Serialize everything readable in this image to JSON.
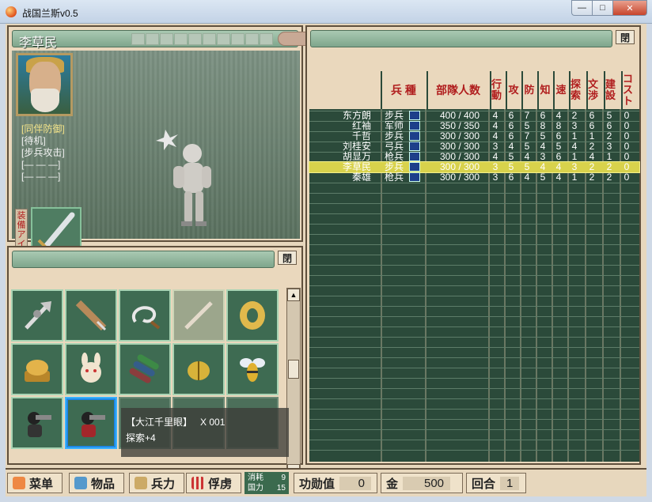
{
  "window": {
    "title": "战国兰斯v0.5",
    "minimize": "—",
    "maximize": "□",
    "close": "✕"
  },
  "general": {
    "name": "李草民",
    "commands": [
      "[同伴防御]",
      "[待机]",
      "[步兵攻击]",
      "[— — —]",
      "[— — —]"
    ],
    "equip_label": "装備アイテム"
  },
  "item_panel": {
    "open_label": "閉"
  },
  "roster_panel": {
    "open_label": "閉"
  },
  "tooltip": {
    "name": "【大江千里眼】",
    "qty": "X 001",
    "effect": "探索+4"
  },
  "table": {
    "headers": {
      "type": "兵 種",
      "troops": "部隊人数",
      "stats": [
        "行動",
        "攻",
        "防",
        "知",
        "速",
        "探索",
        "文渉",
        "建設",
        "コスト"
      ]
    },
    "rows": [
      {
        "name": "东方朗",
        "type": "步兵",
        "troops": "400 / 400",
        "stats": [
          "4",
          "6",
          "7",
          "6",
          "4",
          "2",
          "6",
          "5",
          "0"
        ],
        "hl": false
      },
      {
        "name": "红袖",
        "type": "军师",
        "troops": "350 / 350",
        "stats": [
          "4",
          "6",
          "5",
          "8",
          "8",
          "3",
          "6",
          "6",
          "0"
        ],
        "hl": false
      },
      {
        "name": "千哲",
        "type": "步兵",
        "troops": "300 / 300",
        "stats": [
          "4",
          "6",
          "7",
          "5",
          "6",
          "1",
          "1",
          "2",
          "0"
        ],
        "hl": false
      },
      {
        "name": "刘桂安",
        "type": "弓兵",
        "troops": "300 / 300",
        "stats": [
          "3",
          "4",
          "5",
          "4",
          "5",
          "4",
          "2",
          "3",
          "0"
        ],
        "hl": false
      },
      {
        "name": "胡显万",
        "type": "枪兵",
        "troops": "300 / 300",
        "stats": [
          "4",
          "5",
          "4",
          "3",
          "6",
          "1",
          "4",
          "1",
          "0"
        ],
        "hl": false
      },
      {
        "name": "李草民",
        "type": "步兵",
        "troops": "300 / 300",
        "stats": [
          "3",
          "5",
          "5",
          "4",
          "4",
          "3",
          "2",
          "2",
          "0"
        ],
        "hl": true
      },
      {
        "name": "秦雄",
        "type": "枪兵",
        "troops": "300 / 300",
        "stats": [
          "3",
          "6",
          "4",
          "5",
          "4",
          "1",
          "2",
          "2",
          "0"
        ],
        "hl": false
      }
    ]
  },
  "bottom": {
    "menu": "菜单",
    "items": "物品",
    "army": "兵力",
    "captives": "俘虏",
    "consume_label": "消耗",
    "consume_val": "9",
    "power_label": "国力",
    "power_val": "15",
    "merit_label": "功勋值",
    "merit_val": "0",
    "gold_label": "金",
    "gold_val": "500",
    "turn_label": "回合",
    "turn_val": "1"
  },
  "colors": {
    "frame": "#5f4f3c",
    "header_green": "#7fa68c",
    "highlight": "#d8d24c",
    "stat_red": "#b01d1d"
  }
}
